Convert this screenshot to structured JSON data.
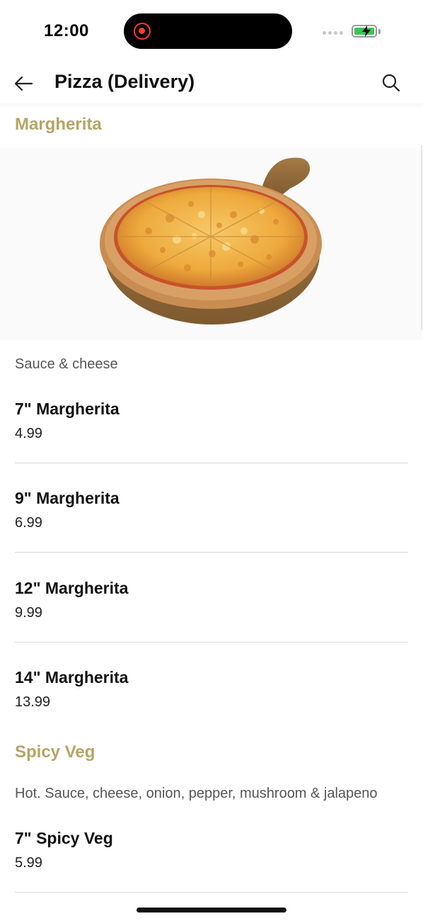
{
  "status_bar": {
    "time": "12:00",
    "icons": [
      "record-icon",
      "signal-dots-icon",
      "battery-charging-icon"
    ],
    "battery_color": "#34c759",
    "record_color": "#ff3b30"
  },
  "header": {
    "title": "Pizza (Delivery)",
    "back_icon": "arrow-left-icon",
    "search_icon": "search-icon"
  },
  "accent_color": "#b5a565",
  "sections": [
    {
      "title": "Margherita",
      "description": "Sauce & cheese",
      "items": [
        {
          "name": "7\" Margherita",
          "price": "4.99"
        },
        {
          "name": "9\" Margherita",
          "price": "6.99"
        },
        {
          "name": "12\" Margherita",
          "price": "9.99"
        },
        {
          "name": "14\" Margherita",
          "price": "13.99"
        }
      ]
    },
    {
      "title": "Spicy Veg",
      "description": "Hot. Sauce, cheese, onion, pepper, mushroom & jalapeno",
      "items": [
        {
          "name": "7\" Spicy Veg",
          "price": "5.99"
        }
      ]
    }
  ]
}
